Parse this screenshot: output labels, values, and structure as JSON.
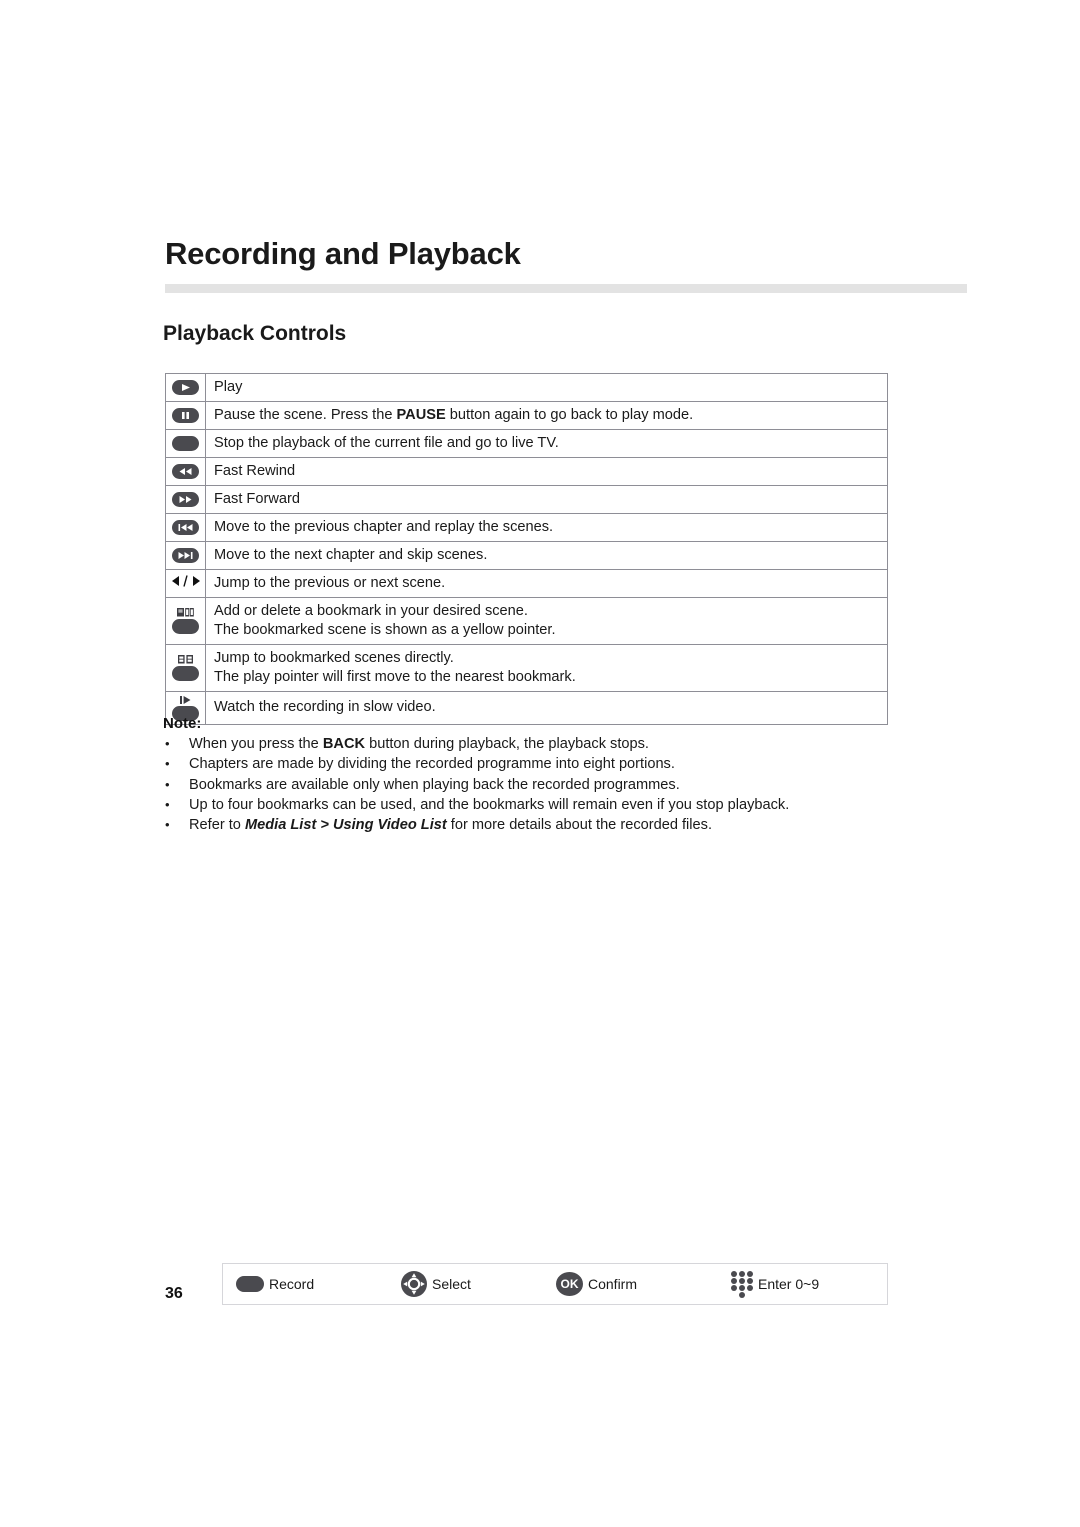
{
  "document": {
    "chapter_title": "Recording and Playback",
    "section_title": "Playback Controls",
    "page_number": "36"
  },
  "controls_table": {
    "rows": [
      {
        "icon": "play-button-icon",
        "icon_kind": "pill",
        "glyph": "play",
        "lines": [
          {
            "parts": [
              {
                "text": "Play",
                "style": "normal"
              }
            ]
          }
        ]
      },
      {
        "icon": "pause-button-icon",
        "icon_kind": "pill",
        "glyph": "pause",
        "lines": [
          {
            "parts": [
              {
                "text": "Pause the scene. Press the ",
                "style": "normal"
              },
              {
                "text": "PAUSE",
                "style": "bold"
              },
              {
                "text": " button again to go back to play mode.",
                "style": "normal"
              }
            ]
          }
        ]
      },
      {
        "icon": "stop-button-icon",
        "icon_kind": "pill",
        "glyph": "none",
        "lines": [
          {
            "parts": [
              {
                "text": "Stop the playback of the current file and go to live TV.",
                "style": "normal"
              }
            ]
          }
        ]
      },
      {
        "icon": "fast-rewind-button-icon",
        "icon_kind": "pill",
        "glyph": "rewind",
        "lines": [
          {
            "parts": [
              {
                "text": "Fast Rewind",
                "style": "normal"
              }
            ]
          }
        ]
      },
      {
        "icon": "fast-forward-button-icon",
        "icon_kind": "pill",
        "glyph": "forward",
        "lines": [
          {
            "parts": [
              {
                "text": "Fast Forward",
                "style": "normal"
              }
            ]
          }
        ]
      },
      {
        "icon": "previous-chapter-button-icon",
        "icon_kind": "pill",
        "glyph": "skip-prev",
        "lines": [
          {
            "parts": [
              {
                "text": "Move to the previous chapter and replay the scenes.",
                "style": "normal"
              }
            ]
          }
        ]
      },
      {
        "icon": "next-chapter-button-icon",
        "icon_kind": "pill",
        "glyph": "skip-next",
        "lines": [
          {
            "parts": [
              {
                "text": "Move to the next chapter and skip scenes.",
                "style": "normal"
              }
            ]
          }
        ]
      },
      {
        "icon": "left-right-arrow-icon",
        "icon_kind": "arrows",
        "glyph": "left-slash-right",
        "lines": [
          {
            "parts": [
              {
                "text": "Jump to the previous or next scene.",
                "style": "normal"
              }
            ]
          }
        ]
      },
      {
        "icon": "add-bookmark-button-icon",
        "icon_kind": "stack",
        "glyph": "bookmark-add",
        "lines": [
          {
            "parts": [
              {
                "text": "Add or delete a bookmark in your desired scene.",
                "style": "normal"
              }
            ]
          },
          {
            "parts": [
              {
                "text": "The bookmarked scene is shown as a yellow pointer.",
                "style": "normal"
              }
            ]
          }
        ]
      },
      {
        "icon": "jump-bookmark-button-icon",
        "icon_kind": "stack",
        "glyph": "bookmark-list",
        "lines": [
          {
            "parts": [
              {
                "text": "Jump to bookmarked scenes directly.",
                "style": "normal"
              }
            ]
          },
          {
            "parts": [
              {
                "text": "The play pointer will first move to the nearest bookmark.",
                "style": "normal"
              }
            ]
          }
        ]
      },
      {
        "icon": "slow-motion-button-icon",
        "icon_kind": "stack",
        "glyph": "slow",
        "lines": [
          {
            "parts": [
              {
                "text": "Watch the recording in slow video.",
                "style": "normal"
              }
            ]
          }
        ]
      }
    ]
  },
  "note": {
    "heading": "Note:",
    "bullet": "•",
    "items": [
      {
        "parts": [
          {
            "text": "When you press the ",
            "style": "normal"
          },
          {
            "text": "BACK",
            "style": "bold"
          },
          {
            "text": " button during playback, the playback stops.",
            "style": "normal"
          }
        ]
      },
      {
        "parts": [
          {
            "text": "Chapters are made by dividing the recorded programme into eight portions.",
            "style": "normal"
          }
        ]
      },
      {
        "parts": [
          {
            "text": "Bookmarks are available only when playing back the recorded programmes.",
            "style": "normal"
          }
        ]
      },
      {
        "parts": [
          {
            "text": "Up to four bookmarks can be used, and the bookmarks will remain even if you stop playback.",
            "style": "normal"
          }
        ]
      },
      {
        "parts": [
          {
            "text": "Refer to ",
            "style": "normal"
          },
          {
            "text": "Media List > Using Video List",
            "style": "bold-italic"
          },
          {
            "text": " for more details about the recorded files.",
            "style": "normal"
          }
        ]
      }
    ]
  },
  "footer": {
    "items": [
      {
        "icon": "record-button-icon",
        "label": "Record"
      },
      {
        "icon": "dpad-select-icon",
        "label": "Select"
      },
      {
        "icon": "ok-button-icon",
        "label": "Confirm",
        "icon_text": "OK"
      },
      {
        "icon": "number-keypad-icon",
        "label": "Enter 0~9"
      }
    ]
  },
  "colors": {
    "button_dark": "#4a4a4f",
    "rule_gray": "#e3e3e3",
    "table_border": "#8e8e96",
    "footer_border": "#d6d6da",
    "text": "#1a1a1a"
  }
}
